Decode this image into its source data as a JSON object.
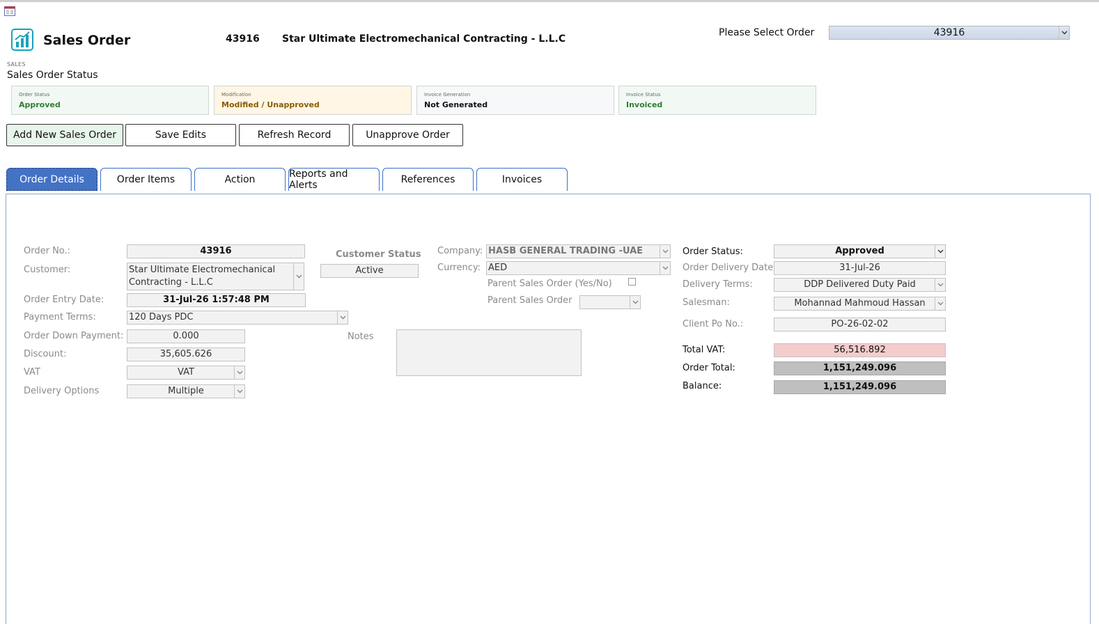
{
  "header": {
    "app_title": "Sales Order",
    "order_no": "43916",
    "customer_name": "Star Ultimate Electromechanical Contracting - L.L.C",
    "select_label": "Please Select Order",
    "select_value": "43916"
  },
  "status_section": {
    "tag": "SALES",
    "title": "Sales Order Status",
    "cards": [
      {
        "label": "Order Status",
        "value": "Approved",
        "color": "#2e7d32",
        "bg": "#f2f9f4"
      },
      {
        "label": "Modification",
        "value": "Modified / Unapproved",
        "color": "#8a5a00",
        "bg": "#fff6e6"
      },
      {
        "label": "Invoice Generation",
        "value": "Not Generated",
        "color": "#111111",
        "bg": "#f7f8fa"
      },
      {
        "label": "Invoice Status",
        "value": "Invoiced",
        "color": "#2e7d32",
        "bg": "#f2f9f4"
      }
    ]
  },
  "actions": {
    "add_new": "Add New Sales Order",
    "save_edits": "Save Edits",
    "refresh": "Refresh Record",
    "unapprove": "Unapprove Order"
  },
  "tabs": [
    {
      "label": "Order Details"
    },
    {
      "label": "Order Items"
    },
    {
      "label": "Action"
    },
    {
      "label": "Reports and Alerts"
    },
    {
      "label": "References"
    },
    {
      "label": "Invoices"
    }
  ],
  "form": {
    "order_no_label": "Order No.:",
    "order_no_value": "43916",
    "customer_label": "Customer:",
    "customer_value": "Star Ultimate Electromechanical Contracting - L.L.C",
    "entry_date_label": "Order Entry Date:",
    "entry_date_value": "31-Jul-26 1:57:48 PM",
    "payment_terms_label": "Payment Terms:",
    "payment_terms_value": "120 Days PDC",
    "down_payment_label": "Order Down Payment:",
    "down_payment_value": "0.000",
    "discount_label": "Discount:",
    "discount_value": "35,605.626",
    "vat_label": "VAT",
    "vat_value": "VAT",
    "delivery_options_label": "Delivery Options",
    "delivery_options_value": "Multiple",
    "customer_status_label": "Customer Status",
    "customer_status_value": "Active",
    "notes_label": "Notes",
    "company_label": "Company:",
    "company_value": "HASB GENERAL TRADING -UAE",
    "currency_label": "Currency:",
    "currency_value": "AED",
    "parent_yesno_label": "Parent Sales Order (Yes/No)",
    "parent_order_label": "Parent Sales Order",
    "order_status_label": "Order Status:",
    "order_status_value": "Approved",
    "delivery_date_label": "Order Delivery Date:",
    "delivery_date_value": "31-Jul-26",
    "delivery_terms_label": "Delivery Terms:",
    "delivery_terms_value": "DDP Delivered Duty Paid",
    "salesman_label": "Salesman:",
    "salesman_value": "Mohannad Mahmoud Hassan",
    "client_po_label": "Client Po No.:",
    "client_po_value": "PO-26-02-02",
    "total_vat_label": "Total VAT:",
    "total_vat_value": "56,516.892",
    "order_total_label": "Order Total:",
    "order_total_value": "1,151,249.096",
    "balance_label": "Balance:",
    "balance_value": "1,151,249.096"
  }
}
